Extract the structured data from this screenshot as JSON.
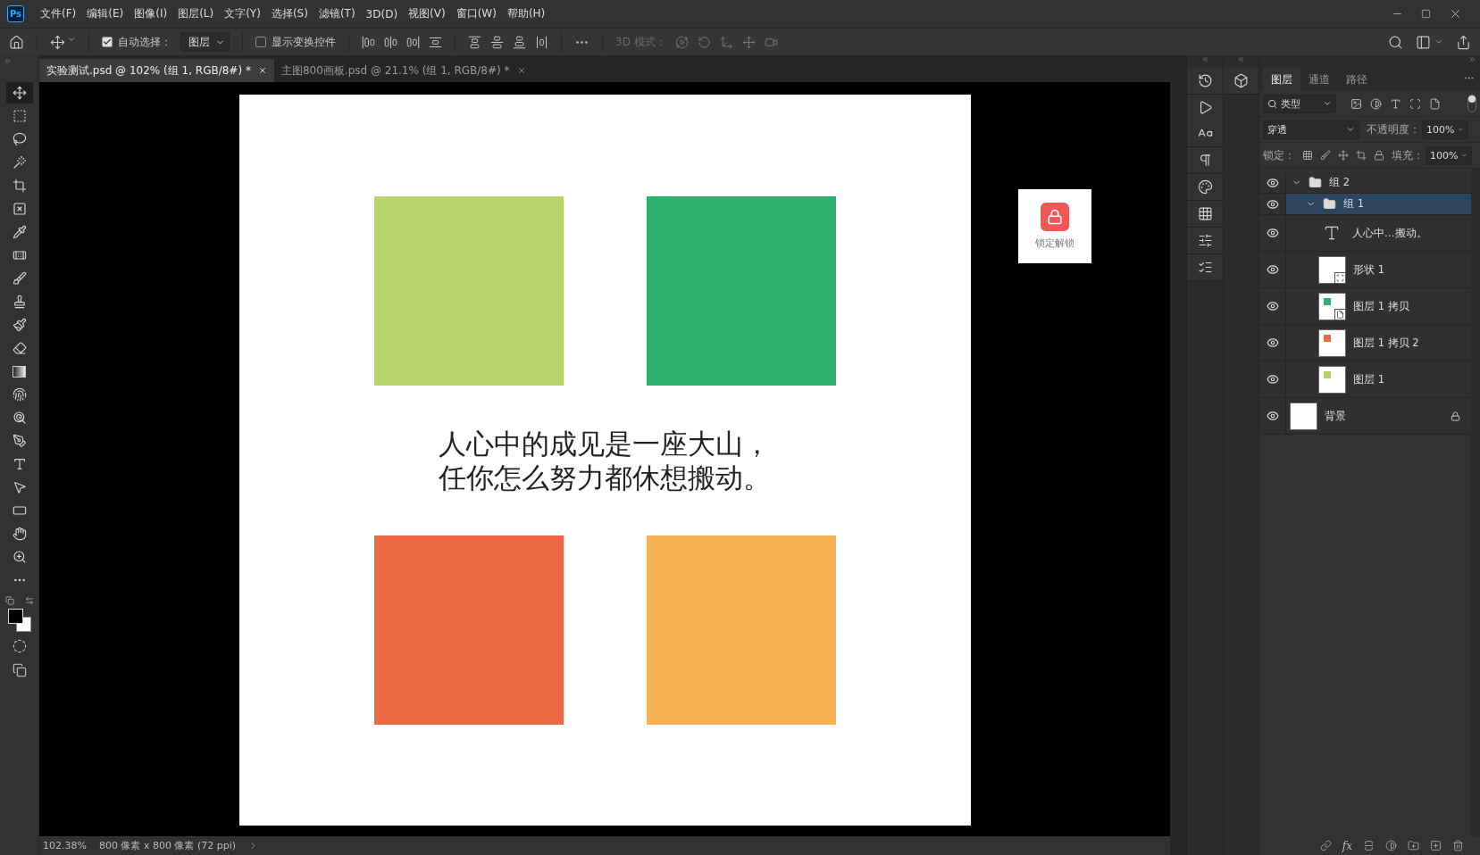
{
  "app": {
    "logo": "Ps"
  },
  "menu": [
    "文件(F)",
    "编辑(E)",
    "图像(I)",
    "图层(L)",
    "文字(Y)",
    "选择(S)",
    "滤镜(T)",
    "3D(D)",
    "视图(V)",
    "窗口(W)",
    "帮助(H)"
  ],
  "options_bar": {
    "auto_select": {
      "label": "自动选择：",
      "checked": true
    },
    "target": {
      "value": "图层"
    },
    "show_transform": {
      "label": "显示变换控件",
      "checked": false
    },
    "mode_3d_label": "3D 模式："
  },
  "tabs": [
    {
      "label": "实验测试.psd @ 102% (组 1, RGB/8#) *",
      "selected": true
    },
    {
      "label": "主图800画板.psd @ 21.1% (组 1, RGB/8#) *",
      "selected": false
    }
  ],
  "tools": [
    {
      "kind": "move",
      "selected": true
    },
    {
      "kind": "marquee",
      "selected": false
    },
    {
      "kind": "lasso",
      "selected": false
    },
    {
      "kind": "quick",
      "selected": false
    },
    {
      "kind": "crop",
      "selected": false
    },
    {
      "kind": "frame",
      "selected": false
    },
    {
      "kind": "eyedropper",
      "selected": false
    },
    {
      "kind": "heal",
      "selected": false
    },
    {
      "kind": "brush",
      "selected": false
    },
    {
      "kind": "stamp",
      "selected": false
    },
    {
      "kind": "history",
      "selected": false
    },
    {
      "kind": "eraser",
      "selected": false
    },
    {
      "kind": "gradient",
      "selected": false
    },
    {
      "kind": "smudge",
      "selected": false
    },
    {
      "kind": "dodge",
      "selected": false
    },
    {
      "kind": "pen",
      "selected": false
    },
    {
      "kind": "type",
      "selected": false
    },
    {
      "kind": "path",
      "selected": false
    },
    {
      "kind": "rect",
      "selected": false
    },
    {
      "kind": "hand",
      "selected": false
    },
    {
      "kind": "zoom",
      "selected": false
    },
    {
      "kind": "more",
      "selected": false
    }
  ],
  "canvas": {
    "squares": [
      {
        "color": "#b7d46a"
      },
      {
        "color": "#2db16d"
      },
      {
        "color": "#ec6a43"
      },
      {
        "color": "#f6b552"
      }
    ],
    "text_lines": [
      "人心中的成见是一座大山，",
      "任你怎么努力都休想搬动。"
    ]
  },
  "lock_overlay": {
    "label": "锁定解锁"
  },
  "status_bar": {
    "zoom": "102.38%",
    "doc_info": "800 像素 x 800 像素 (72 ppi)"
  },
  "layers_panel": {
    "tabs": [
      {
        "label": "图层",
        "selected": true
      },
      {
        "label": "通道",
        "selected": false
      },
      {
        "label": "路径",
        "selected": false
      }
    ],
    "filter": {
      "value": "类型"
    },
    "filter_on": true,
    "blend_mode": {
      "value": "穿透"
    },
    "opacity": {
      "label": "不透明度：",
      "value": "100%"
    },
    "lock_label": "锁定：",
    "fill": {
      "label": "填充：",
      "value": "100%"
    },
    "layers": [
      {
        "kind": "group",
        "name": "组 2",
        "visible": true,
        "expanded": true,
        "selected": false,
        "children": [
          {
            "kind": "group",
            "name": "组 1",
            "visible": true,
            "expanded": true,
            "selected": true,
            "children": [
              {
                "kind": "text",
                "name": "人心中…搬动。",
                "visible": true,
                "selected": false
              },
              {
                "kind": "shape",
                "name": "形状 1",
                "visible": true,
                "selected": false
              },
              {
                "kind": "smart",
                "name": "图层 1 拷贝",
                "visible": true,
                "selected": false,
                "color": "#2db16d"
              },
              {
                "kind": "pixel",
                "name": "图层 1 拷贝 2",
                "visible": true,
                "selected": false,
                "color": "#ec6a43"
              },
              {
                "kind": "pixel",
                "name": "图层 1",
                "visible": true,
                "selected": false,
                "color": "#b7d46a"
              }
            ]
          }
        ]
      },
      {
        "kind": "background",
        "name": "背景",
        "visible": true,
        "selected": false,
        "locked": true
      }
    ],
    "fx_button": "fx"
  }
}
